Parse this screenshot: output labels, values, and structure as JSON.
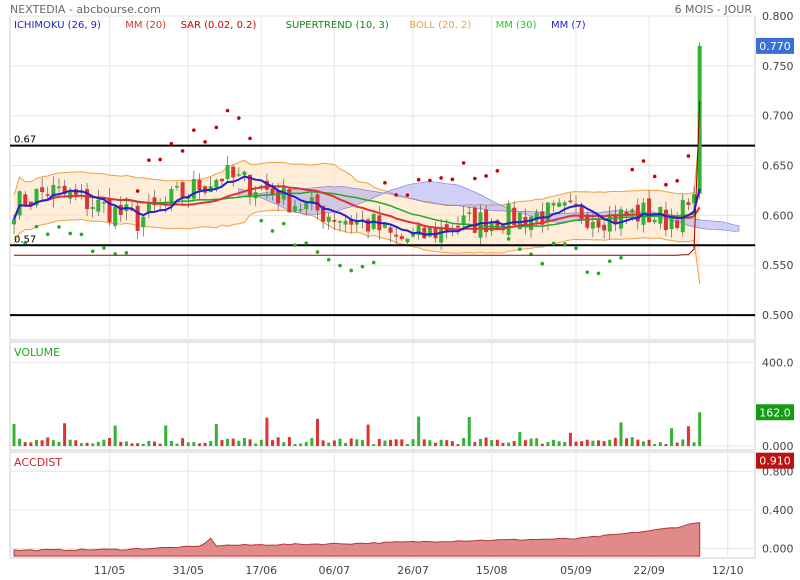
{
  "header": {
    "title": "NEXTEDIA - abcbourse.com",
    "period": "6 MOIS - JOUR"
  },
  "colors": {
    "up": "#34b234",
    "down": "#dd3333",
    "ichimoku_cloud": "#9999ee",
    "bollinger": "#f0a040",
    "mm30": "#22aa22",
    "mm7": "#2222cc",
    "sar": "#cc0000",
    "supertrend_up": "#22aa22",
    "supertrend_line": "#990000",
    "mm20": "#dd3333"
  },
  "chart_data": [
    {
      "type": "candlestick",
      "legend": [
        {
          "label": "ICHIMOKU (26, 9)",
          "color": "#2222cc"
        },
        {
          "label": "MM (20)",
          "color": "#dd3333"
        },
        {
          "label": "SAR (0.02, 0.2)",
          "color": "#cc0000"
        },
        {
          "label": "SUPERTREND (10, 3)",
          "color": "#118811"
        },
        {
          "label": "BOLL (20, 2)",
          "color": "#f0a040"
        },
        {
          "label": "MM (30)",
          "color": "#22cc22"
        },
        {
          "label": "MM (7)",
          "color": "#2222cc"
        }
      ],
      "ylim": [
        0.475,
        0.8
      ],
      "y_ticks": [
        "0.800",
        "0.750",
        "0.700",
        "0.650",
        "0.600",
        "0.550",
        "0.500"
      ],
      "last_price": "0.770",
      "levels": [
        {
          "value": 0.67,
          "label": "0.67"
        },
        {
          "value": 0.57,
          "label": "0.57"
        },
        {
          "value": 0.5,
          "label": ""
        }
      ],
      "x_labels": [
        "11/05",
        "31/05",
        "17/06",
        "06/07",
        "26/07",
        "15/08",
        "05/09",
        "22/09",
        "12/10"
      ]
    },
    {
      "type": "bar",
      "title": "VOLUME",
      "ylim": [
        0,
        480
      ],
      "y_ticks": [
        "400.0",
        "0.000"
      ],
      "last_value": "162.0"
    },
    {
      "type": "area",
      "title": "ACCDIST",
      "ylim": [
        -0.1,
        1.0
      ],
      "y_ticks": [
        "0.800",
        "0.400",
        "0.000"
      ],
      "last_value": "0.910"
    }
  ]
}
